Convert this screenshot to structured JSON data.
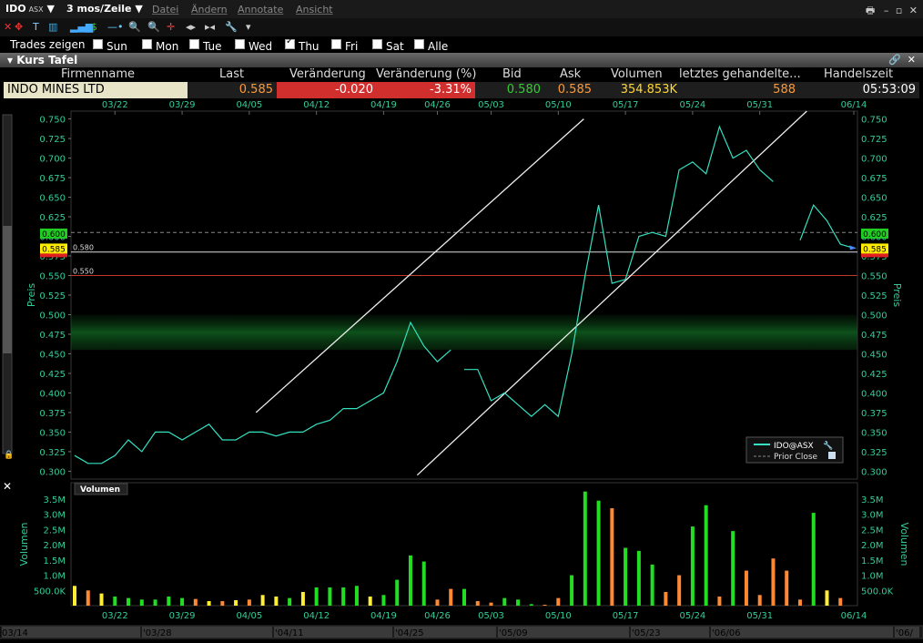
{
  "window": {
    "symbol": "IDO",
    "exchange": "ASX",
    "period": "3 mos/Zeile",
    "menus": [
      "Datei",
      "Ändern",
      "Annotate",
      "Ansicht"
    ]
  },
  "trades": {
    "label": "Trades zeigen",
    "days": [
      {
        "label": "Sun",
        "checked": false
      },
      {
        "label": "Mon",
        "checked": false
      },
      {
        "label": "Tue",
        "checked": false
      },
      {
        "label": "Wed",
        "checked": false
      },
      {
        "label": "Thu",
        "checked": true
      },
      {
        "label": "Fri",
        "checked": false
      },
      {
        "label": "Sat",
        "checked": false
      },
      {
        "label": "Alle",
        "checked": false
      }
    ]
  },
  "panel": {
    "title": "Kurs Tafel"
  },
  "quote_table": {
    "headers": [
      "Firmenname",
      "Last",
      "Veränderung",
      "Veränderung (%)",
      "Bid",
      "Ask",
      "Volumen",
      "letztes gehandelte...",
      "Handelszeit"
    ],
    "row": {
      "name": "INDO MINES LTD",
      "last": "0.585",
      "change": "-0.020",
      "change_pct": "-3.31%",
      "bid": "0.580",
      "ask": "0.585",
      "volume": "354.853K",
      "last_size": "588",
      "time": "05:53:09"
    }
  },
  "colors": {
    "price_line": "#33e0c0",
    "bid_green": "#33cc33",
    "ask_orange": "#ff9933",
    "volume_yellow": "#ffd633",
    "change_red": "#d12e2e",
    "axis_text": "#33cc99"
  },
  "chart_data": [
    {
      "type": "line",
      "name": "price",
      "ylabel": "Preis",
      "ylim": [
        0.29,
        0.76
      ],
      "y_ticks": [
        "0.300",
        "0.325",
        "0.350",
        "0.375",
        "0.400",
        "0.425",
        "0.450",
        "0.475",
        "0.500",
        "0.525",
        "0.550",
        "0.575",
        "0.600",
        "0.625",
        "0.650",
        "0.675",
        "0.700",
        "0.725",
        "0.750"
      ],
      "top_date_labels": [
        "03/22",
        "03/29",
        "04/05",
        "04/12",
        "04/19",
        "04/26",
        "05/03",
        "05/10",
        "05/17",
        "05/24",
        "05/31",
        "06/14"
      ],
      "legend": {
        "entries": [
          "IDO@ASX",
          "Prior Close"
        ],
        "placement": "bottom-right"
      },
      "reference_lines": [
        {
          "label": "0.580",
          "value": 0.58
        },
        {
          "label": "0.550",
          "value": 0.55
        }
      ],
      "price_tags": {
        "bid": "0.600",
        "last": "0.585"
      },
      "series": [
        {
          "name": "IDO@ASX",
          "segments": [
            [
              [
                0,
                0.32
              ],
              [
                1,
                0.31
              ],
              [
                2,
                0.31
              ],
              [
                3,
                0.32
              ],
              [
                4,
                0.34
              ],
              [
                5,
                0.325
              ],
              [
                6,
                0.35
              ],
              [
                7,
                0.35
              ],
              [
                8,
                0.34
              ],
              [
                9,
                0.35
              ],
              [
                10,
                0.36
              ],
              [
                11,
                0.34
              ],
              [
                12,
                0.34
              ],
              [
                13,
                0.35
              ],
              [
                14,
                0.35
              ],
              [
                15,
                0.345
              ],
              [
                16,
                0.35
              ],
              [
                17,
                0.35
              ],
              [
                18,
                0.36
              ],
              [
                19,
                0.365
              ],
              [
                20,
                0.38
              ],
              [
                21,
                0.38
              ],
              [
                22,
                0.39
              ],
              [
                23,
                0.4
              ],
              [
                24,
                0.44
              ],
              [
                25,
                0.49
              ],
              [
                26,
                0.46
              ],
              [
                27,
                0.44
              ],
              [
                28,
                0.455
              ]
            ],
            [
              [
                29,
                0.43
              ],
              [
                30,
                0.43
              ],
              [
                31,
                0.39
              ],
              [
                32,
                0.4
              ],
              [
                33,
                0.385
              ],
              [
                34,
                0.37
              ],
              [
                35,
                0.385
              ],
              [
                36,
                0.37
              ],
              [
                37,
                0.45
              ],
              [
                38,
                0.55
              ],
              [
                39,
                0.64
              ],
              [
                40,
                0.54
              ],
              [
                41,
                0.545
              ],
              [
                42,
                0.6
              ],
              [
                43,
                0.605
              ],
              [
                44,
                0.6
              ],
              [
                45,
                0.685
              ],
              [
                46,
                0.695
              ],
              [
                47,
                0.68
              ],
              [
                48,
                0.74
              ],
              [
                49,
                0.7
              ],
              [
                50,
                0.71
              ],
              [
                51,
                0.685
              ],
              [
                52,
                0.67
              ]
            ],
            [
              [
                54,
                0.595
              ],
              [
                55,
                0.64
              ],
              [
                56,
                0.62
              ],
              [
                57,
                0.59
              ],
              [
                58,
                0.585
              ]
            ]
          ]
        }
      ],
      "trendlines": [
        [
          [
            13.5,
            0.375
          ],
          [
            37.9,
            0.75
          ]
        ],
        [
          [
            25.5,
            0.295
          ],
          [
            54.5,
            0.76
          ]
        ]
      ]
    },
    {
      "type": "bar",
      "name": "volume",
      "title": "Volumen",
      "ylabel": "Volumen",
      "ylim": [
        0,
        3800000
      ],
      "y_ticks": [
        "500.0K",
        "1.0M",
        "1.5M",
        "2.0M",
        "2.5M",
        "3.0M",
        "3.5M"
      ],
      "bottom_date_labels": [
        "03/22",
        "03/29",
        "04/05",
        "04/12",
        "04/19",
        "04/26",
        "05/03",
        "05/10",
        "05/17",
        "05/24",
        "05/31",
        "06/14"
      ],
      "axis_dates": [
        "03/14",
        "'03/28",
        "'04/11",
        "'04/25",
        "'05/09",
        "'05/23",
        "'06/06",
        "'06/"
      ],
      "values": [
        650000,
        500000,
        400000,
        300000,
        250000,
        200000,
        200000,
        300000,
        250000,
        220000,
        150000,
        150000,
        180000,
        200000,
        350000,
        300000,
        250000,
        450000,
        600000,
        600000,
        600000,
        650000,
        300000,
        350000,
        850000,
        1650000,
        1450000,
        200000,
        550000,
        550000,
        150000,
        100000,
        250000,
        200000,
        50000,
        30000,
        250000,
        1000000,
        3750000,
        3450000,
        3200000,
        1900000,
        1800000,
        1350000,
        450000,
        1000000,
        2600000,
        3300000,
        300000,
        2450000,
        1150000,
        350000,
        1550000,
        1150000,
        200000,
        3050000,
        500000,
        250000
      ],
      "colors": [
        "y",
        "o",
        "y",
        "g",
        "g",
        "g",
        "g",
        "g",
        "g",
        "o",
        "y",
        "o",
        "y",
        "o",
        "y",
        "y",
        "g",
        "y",
        "g",
        "g",
        "g",
        "g",
        "y",
        "g",
        "g",
        "g",
        "g",
        "o",
        "o",
        "g",
        "o",
        "o",
        "g",
        "g",
        "g",
        "o",
        "o",
        "g",
        "g",
        "g",
        "o",
        "g",
        "g",
        "g",
        "o",
        "o",
        "g",
        "g",
        "o",
        "g",
        "o",
        "o",
        "o",
        "o",
        "o",
        "g",
        "y",
        "o"
      ]
    }
  ]
}
